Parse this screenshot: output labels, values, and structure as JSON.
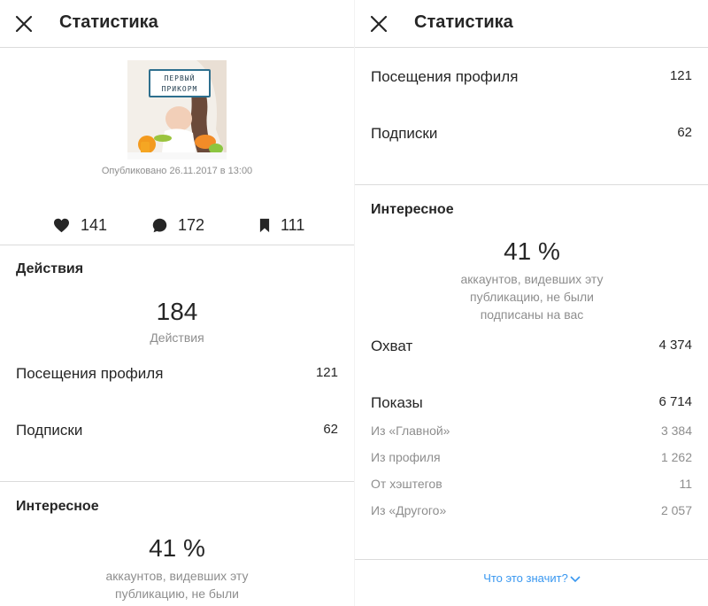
{
  "left": {
    "header": {
      "title": "Статистика"
    },
    "post": {
      "sign_line1": "ПЕРВЫЙ",
      "sign_line2": "ПРИКОРМ",
      "published": "Опубликовано 26.11.2017 в 13:00"
    },
    "stats": {
      "likes": "141",
      "comments": "172",
      "saves": "111"
    },
    "actions": {
      "title": "Действия",
      "count": "184",
      "count_caption": "Действия",
      "rows": [
        {
          "label": "Посещения профиля",
          "value": "121"
        },
        {
          "label": "Подписки",
          "value": "62"
        }
      ]
    },
    "discovery": {
      "title": "Интересное",
      "percent": "41 %",
      "desc": "аккаунтов, видевших эту публикацию, не были подписаны на вас"
    }
  },
  "right": {
    "header": {
      "title": "Статистика"
    },
    "rows": [
      {
        "label": "Посещения профиля",
        "value": "121"
      },
      {
        "label": "Подписки",
        "value": "62"
      }
    ],
    "discovery": {
      "title": "Интересное",
      "percent": "41 %",
      "desc": "аккаунтов, видевших эту публикацию, не были подписаны на вас",
      "reach": {
        "label": "Охват",
        "value": "4 374"
      },
      "impressions": {
        "label": "Показы",
        "value": "6 714"
      },
      "sources": [
        {
          "label": "Из «Главной»",
          "value": "3 384"
        },
        {
          "label": "Из профиля",
          "value": "1 262"
        },
        {
          "label": "От хэштегов",
          "value": "11"
        },
        {
          "label": "Из «Другого»",
          "value": "2 057"
        }
      ]
    },
    "help_link": "Что это значит?"
  },
  "icons": {
    "close": "close-icon",
    "likes": "heart-icon",
    "comments": "comment-icon",
    "saves": "bookmark-icon",
    "help": "chevron-down-icon"
  },
  "colors": {
    "text": "#262626",
    "secondary": "#8e8e8e",
    "divider": "#dbdbdb",
    "link": "#3897f0"
  }
}
